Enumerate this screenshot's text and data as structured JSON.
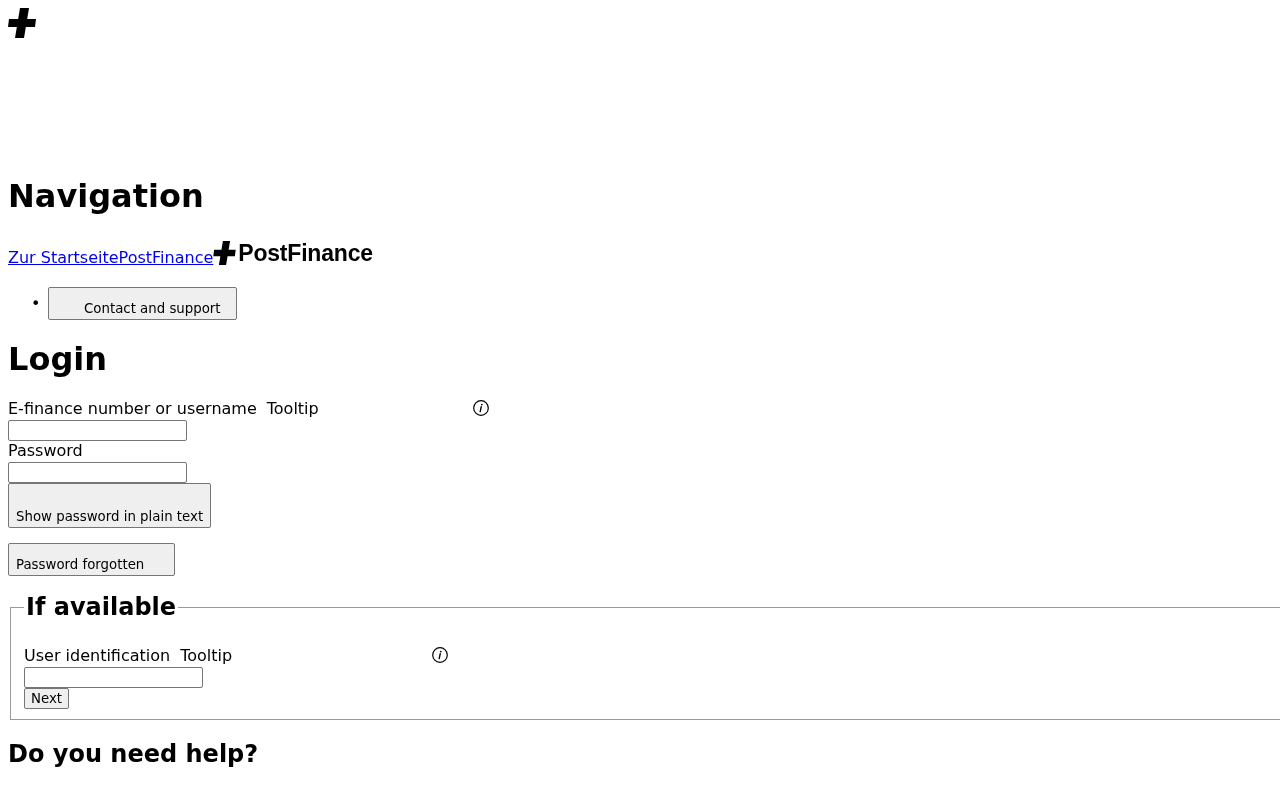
{
  "navigation": {
    "heading": "Navigation",
    "home_link": "Zur StartseitePostFinance",
    "brand": "PostFinance",
    "menu": [
      {
        "marker": "•",
        "label": "Contact and support"
      }
    ]
  },
  "login": {
    "heading": "Login",
    "fields": [
      {
        "label": "E-finance number or username",
        "tooltip": "Tooltip"
      },
      {
        "label": "Password"
      }
    ],
    "show_password_button": "Show password in plain text",
    "forgot_password_button": "Password forgotten",
    "optional_section": {
      "legend": "If available",
      "field": {
        "label": "User identification",
        "tooltip": "Tooltip"
      },
      "next_button": "Next"
    }
  },
  "help": {
    "heading": "Do you need help?"
  }
}
